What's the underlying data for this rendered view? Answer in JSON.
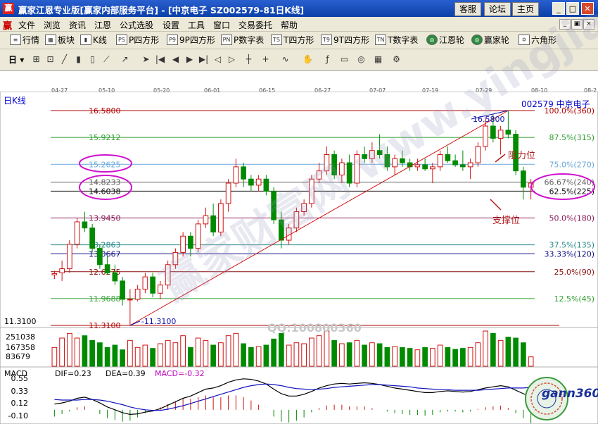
{
  "titlebar": {
    "app_title": "赢家江恩专业版[赢家内部服务平台] - [中京电子  SZ002579-81日K线]",
    "buttons": [
      "客服",
      "论坛",
      "主页"
    ],
    "win_min": "_",
    "win_max": "□",
    "win_close": "✕"
  },
  "menubar": {
    "logo": "赢",
    "items": [
      "文件",
      "浏览",
      "资讯",
      "江恩",
      "公式选股",
      "设置",
      "工具",
      "窗口",
      "交易委托",
      "帮助"
    ],
    "mdi": [
      "_",
      "▣",
      "×"
    ]
  },
  "toolbar1": {
    "items": [
      {
        "icon": "≡",
        "label": "行情"
      },
      {
        "icon": "▦",
        "label": "板块"
      },
      {
        "icon": "▮",
        "label": "K线"
      },
      {
        "icon": "PS",
        "label": "P四方形"
      },
      {
        "icon": "P9",
        "label": "9P四方形"
      },
      {
        "icon": "PN",
        "label": "P数字表"
      },
      {
        "icon": "TS",
        "label": "T四方形"
      },
      {
        "icon": "T9",
        "label": "9T四方形"
      },
      {
        "icon": "TN",
        "label": "T数字表"
      },
      {
        "icon": "◎",
        "label": "江恩轮"
      },
      {
        "icon": "◎",
        "label": "赢家轮"
      },
      {
        "icon": "✡",
        "label": "六角形"
      }
    ]
  },
  "toolbar2": {
    "period": "日",
    "icons": [
      "cursor",
      "chart",
      "line",
      "bar",
      "candle",
      "trend",
      "arrow",
      "pointer",
      "first",
      "prev",
      "next",
      "last",
      "left",
      "right",
      "cross",
      "plus",
      "zigzag",
      "hand",
      "fib",
      "box",
      "gann",
      "calc",
      "gear"
    ]
  },
  "dates": [
    "04-27",
    "05-10",
    "05-20",
    "06-01",
    "06-15",
    "06-27",
    "07-07",
    "07-19",
    "07-29",
    "08-10",
    "08-2"
  ],
  "chart": {
    "period_label": "日K线",
    "stock_name": "002579 中京电子",
    "high_label": "16.5800",
    "low_label": "11.3100"
  },
  "annotations": {
    "resistance": "阻力位",
    "support": "支撑位",
    "qq": "QQ:100800360"
  },
  "volume_axis": [
    "251038",
    "167358",
    "83679"
  ],
  "macd": {
    "label": "MACD",
    "dif": "DIF=0.23",
    "dea": "DEA=0.39",
    "macd": "MACD=-0.32",
    "axis": [
      "0.55",
      "0.33",
      "0.12",
      "-0.10"
    ]
  },
  "logo": {
    "text": "gann360"
  },
  "watermark": "赢家财富网 www.yingjia360.com",
  "chart_data": {
    "type": "candlestick",
    "title": "",
    "xlabel": "",
    "ylabel": "",
    "price_range": [
      11.31,
      16.58
    ],
    "fib_levels": [
      {
        "price": "16.5800",
        "label": "100.0%(360)",
        "color": "#b00000"
      },
      {
        "price": "15.9212",
        "label": "87.5%(315)",
        "color": "#2e9e2e"
      },
      {
        "price": "15.2625",
        "label": "75.0%(270)",
        "color": "#6aa8d8"
      },
      {
        "price": "14.8233",
        "label": "66.67%(240)",
        "color": "#606060"
      },
      {
        "price": "14.6038",
        "label": "62.5%(225)",
        "color": "#101010"
      },
      {
        "price": "13.9450",
        "label": "50.0%(180)",
        "color": "#8a1a5a"
      },
      {
        "price": "13.2863",
        "label": "37.5%(135)",
        "color": "#2a8a8a"
      },
      {
        "price": "13.0667",
        "label": "33.33%(120)",
        "color": "#101080"
      },
      {
        "price": "12.6275",
        "label": "25.0%(90)",
        "color": "#8a1010"
      },
      {
        "price": "11.9688",
        "label": "12.5%(45)",
        "color": "#2e9e2e"
      },
      {
        "price": "11.3100",
        "label": "",
        "color": "#b00000"
      }
    ],
    "candles": [
      [
        12.55,
        12.65,
        12.45,
        12.58
      ],
      [
        12.6,
        12.9,
        12.4,
        12.7
      ],
      [
        12.7,
        13.4,
        12.6,
        13.3
      ],
      [
        13.3,
        13.95,
        13.2,
        13.85
      ],
      [
        13.85,
        14.1,
        13.6,
        13.7
      ],
      [
        13.7,
        13.8,
        13.1,
        13.2
      ],
      [
        13.2,
        13.3,
        12.7,
        12.8
      ],
      [
        12.8,
        13.0,
        12.55,
        12.6
      ],
      [
        12.6,
        12.8,
        12.3,
        12.4
      ],
      [
        12.4,
        12.5,
        11.8,
        11.95
      ],
      [
        11.95,
        12.2,
        11.31,
        11.95
      ],
      [
        11.95,
        12.3,
        11.9,
        12.2
      ],
      [
        12.2,
        12.6,
        12.1,
        12.5
      ],
      [
        12.5,
        12.6,
        12.0,
        12.1
      ],
      [
        12.1,
        12.4,
        11.95,
        12.3
      ],
      [
        12.3,
        12.9,
        12.2,
        12.8
      ],
      [
        12.8,
        13.2,
        12.7,
        13.1
      ],
      [
        13.1,
        13.6,
        13.0,
        13.5
      ],
      [
        13.5,
        13.6,
        13.0,
        13.2
      ],
      [
        13.2,
        13.9,
        13.1,
        13.8
      ],
      [
        13.8,
        14.2,
        13.7,
        14.0
      ],
      [
        14.0,
        14.3,
        13.5,
        13.6
      ],
      [
        13.6,
        14.4,
        13.5,
        14.3
      ],
      [
        14.3,
        14.9,
        14.1,
        14.8
      ],
      [
        14.8,
        15.4,
        14.7,
        15.2
      ],
      [
        15.2,
        15.3,
        14.7,
        14.9
      ],
      [
        14.9,
        15.0,
        14.6,
        14.75
      ],
      [
        14.75,
        15.0,
        14.6,
        14.9
      ],
      [
        14.9,
        15.0,
        14.5,
        14.6
      ],
      [
        14.6,
        14.7,
        13.8,
        13.9
      ],
      [
        13.9,
        14.1,
        13.2,
        13.4
      ],
      [
        13.4,
        13.8,
        13.3,
        13.7
      ],
      [
        13.7,
        14.2,
        13.6,
        14.1
      ],
      [
        14.1,
        14.4,
        14.0,
        14.3
      ],
      [
        14.3,
        15.0,
        14.2,
        14.9
      ],
      [
        14.9,
        15.3,
        14.8,
        15.1
      ],
      [
        15.1,
        15.7,
        15.0,
        15.5
      ],
      [
        15.5,
        15.6,
        14.9,
        15.0
      ],
      [
        15.0,
        15.4,
        14.8,
        15.3
      ],
      [
        15.3,
        15.5,
        14.7,
        14.8
      ],
      [
        14.8,
        15.6,
        14.7,
        15.5
      ],
      [
        15.5,
        15.7,
        15.3,
        15.4
      ],
      [
        15.4,
        15.8,
        15.3,
        15.6
      ],
      [
        15.6,
        16.0,
        15.4,
        15.5
      ],
      [
        15.5,
        15.7,
        15.1,
        15.2
      ],
      [
        15.2,
        15.5,
        15.0,
        15.4
      ],
      [
        15.4,
        15.6,
        15.2,
        15.3
      ],
      [
        15.3,
        15.4,
        15.1,
        15.2
      ],
      [
        15.2,
        15.4,
        15.1,
        15.25
      ],
      [
        15.25,
        15.4,
        15.1,
        15.15
      ],
      [
        15.15,
        15.3,
        14.8,
        15.2
      ],
      [
        15.2,
        15.6,
        15.1,
        15.5
      ],
      [
        15.5,
        15.7,
        15.3,
        15.35
      ],
      [
        15.35,
        15.5,
        15.2,
        15.25
      ],
      [
        15.25,
        15.6,
        15.1,
        15.2
      ],
      [
        15.2,
        15.4,
        14.9,
        15.3
      ],
      [
        15.3,
        15.8,
        15.2,
        15.7
      ],
      [
        15.7,
        16.4,
        15.6,
        16.2
      ],
      [
        16.2,
        16.5,
        15.8,
        15.9
      ],
      [
        15.9,
        16.2,
        15.5,
        16.1
      ],
      [
        16.1,
        16.58,
        15.9,
        16.0
      ],
      [
        16.0,
        16.1,
        15.0,
        15.1
      ],
      [
        15.1,
        15.2,
        14.4,
        14.7
      ],
      [
        14.7,
        14.9,
        14.4,
        14.8
      ]
    ],
    "volume": [
      40,
      60,
      70,
      60,
      65,
      55,
      50,
      40,
      45,
      35,
      55,
      40,
      45,
      38,
      48,
      55,
      50,
      65,
      40,
      60,
      55,
      45,
      50,
      65,
      70,
      48,
      40,
      42,
      45,
      58,
      70,
      45,
      50,
      48,
      60,
      65,
      75,
      55,
      48,
      50,
      55,
      45,
      50,
      48,
      40,
      42,
      40,
      38,
      35,
      40,
      38,
      45,
      40,
      36,
      38,
      40,
      50,
      75,
      70,
      55,
      62,
      60,
      50,
      20
    ],
    "macd": {
      "dif": [
        0.1,
        0.12,
        0.15,
        0.2,
        0.22,
        0.18,
        0.12,
        0.05,
        0.0,
        -0.05,
        -0.08,
        -0.07,
        -0.04,
        -0.02,
        0.02,
        0.08,
        0.14,
        0.2,
        0.24,
        0.3,
        0.36,
        0.38,
        0.42,
        0.48,
        0.52,
        0.54,
        0.53,
        0.5,
        0.45,
        0.36,
        0.28,
        0.24,
        0.24,
        0.27,
        0.32,
        0.38,
        0.42,
        0.45,
        0.46,
        0.45,
        0.46,
        0.47,
        0.46,
        0.44,
        0.41,
        0.38,
        0.36,
        0.34,
        0.32,
        0.3,
        0.3,
        0.32,
        0.33,
        0.32,
        0.31,
        0.32,
        0.35,
        0.38,
        0.4,
        0.42,
        0.4,
        0.34,
        0.28,
        0.23
      ],
      "dea": [
        0.18,
        0.17,
        0.17,
        0.17,
        0.18,
        0.18,
        0.17,
        0.15,
        0.12,
        0.09,
        0.05,
        0.02,
        0.0,
        -0.01,
        -0.01,
        0.01,
        0.04,
        0.07,
        0.11,
        0.15,
        0.19,
        0.23,
        0.27,
        0.31,
        0.35,
        0.39,
        0.42,
        0.44,
        0.45,
        0.44,
        0.42,
        0.39,
        0.37,
        0.36,
        0.35,
        0.36,
        0.37,
        0.39,
        0.4,
        0.41,
        0.42,
        0.43,
        0.44,
        0.44,
        0.43,
        0.42,
        0.41,
        0.4,
        0.38,
        0.37,
        0.36,
        0.35,
        0.35,
        0.34,
        0.34,
        0.34,
        0.34,
        0.35,
        0.36,
        0.37,
        0.38,
        0.38,
        0.38,
        0.39
      ]
    }
  }
}
